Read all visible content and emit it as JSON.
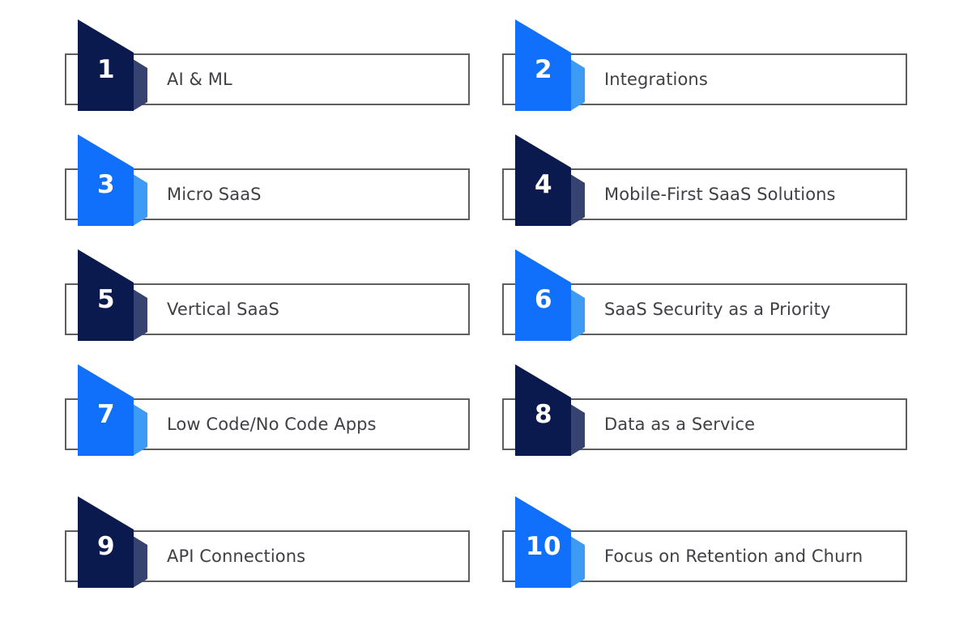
{
  "theme": {
    "background": "#FFFFFF",
    "card_border_color": "#5E5E5E",
    "label_color": "#3F3F46",
    "number_color": "#FFFFFF",
    "navy_body": "#0A1A4F",
    "navy_fold": "#364270",
    "blue_body": "#1070FC",
    "blue_fold": "#3D9AF5"
  },
  "list": {
    "items": [
      {
        "number": "1",
        "label": "AI & ML",
        "color_scheme": "navy"
      },
      {
        "number": "2",
        "label": "Integrations",
        "color_scheme": "blue"
      },
      {
        "number": "3",
        "label": "Micro SaaS",
        "color_scheme": "blue"
      },
      {
        "number": "4",
        "label": "Mobile-First SaaS Solutions",
        "color_scheme": "navy"
      },
      {
        "number": "5",
        "label": "Vertical SaaS",
        "color_scheme": "navy"
      },
      {
        "number": "6",
        "label": "SaaS Security as a Priority",
        "color_scheme": "blue"
      },
      {
        "number": "7",
        "label": "Low Code/No Code Apps",
        "color_scheme": "blue"
      },
      {
        "number": "8",
        "label": "Data as a Service",
        "color_scheme": "navy"
      },
      {
        "number": "9",
        "label": "API Connections",
        "color_scheme": "navy"
      },
      {
        "number": "10",
        "label": "Focus on Retention and Churn",
        "color_scheme": "blue"
      }
    ]
  }
}
